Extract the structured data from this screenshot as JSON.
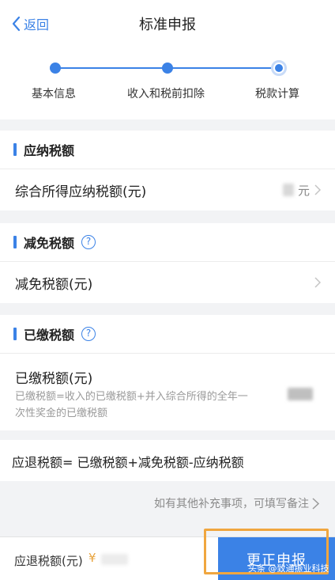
{
  "nav": {
    "back_label": "返回",
    "title": "标准申报"
  },
  "steps": [
    {
      "label": "基本信息",
      "state": "done"
    },
    {
      "label": "收入和税前扣除",
      "state": "done"
    },
    {
      "label": "税款计算",
      "state": "current"
    }
  ],
  "sections": {
    "payable": {
      "title": "应纳税额",
      "row_label": "综合所得应纳税额(元)",
      "row_unit": "元"
    },
    "exempt": {
      "title": "减免税额",
      "row_label": "减免税额(元)"
    },
    "paid": {
      "title": "已缴税额",
      "row_label": "已缴税额(元)",
      "desc_line1": "已缴税额=收入的已缴税额+并入综合所得的全年一",
      "desc_line2": "次性奖金的已缴税额"
    }
  },
  "formula": "应退税额= 已缴税额+减免税额-应纳税额",
  "note_link": "如有其他补充事项，可填写备注",
  "bottom": {
    "refund_label": "应退税额(元)",
    "currency": "¥",
    "submit_label": "更正申报"
  },
  "watermark": "头条 @致通振业科技",
  "colors": {
    "accent": "#3b82e6",
    "highlight": "#f0a63f"
  }
}
